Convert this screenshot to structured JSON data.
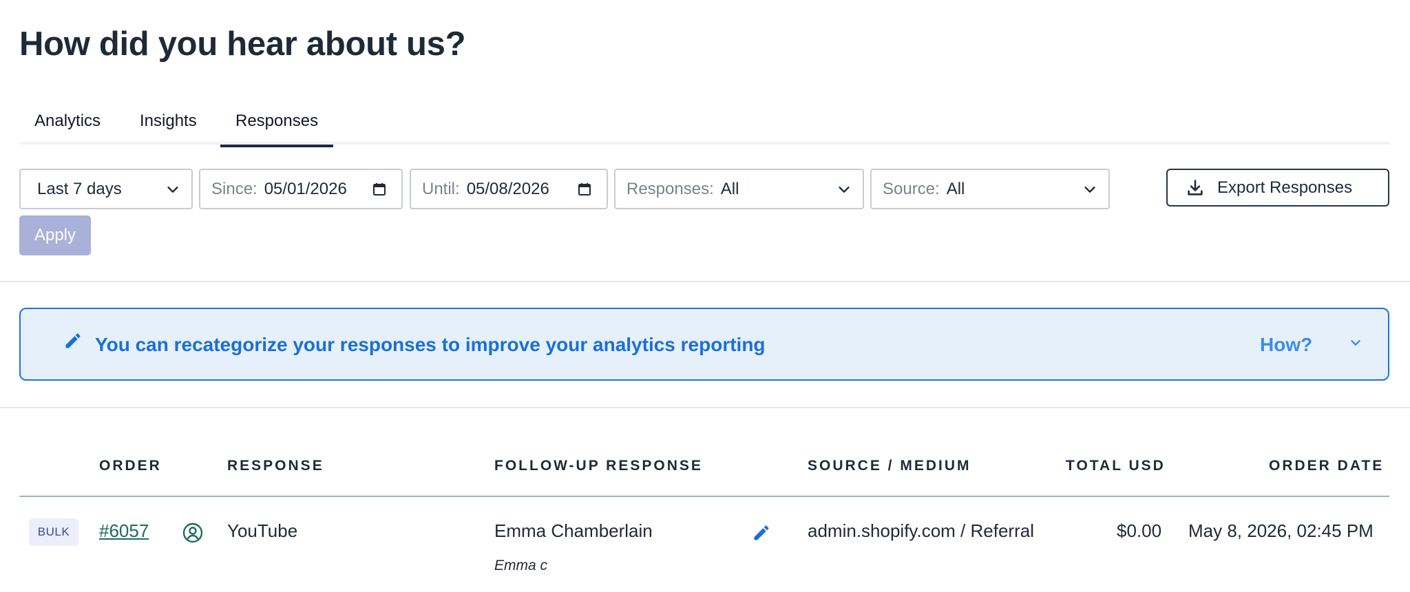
{
  "page": {
    "title": "How did you hear about us?"
  },
  "tabs": [
    {
      "label": "Analytics",
      "active": false
    },
    {
      "label": "Insights",
      "active": false
    },
    {
      "label": "Responses",
      "active": true
    }
  ],
  "filters": {
    "range": {
      "value": "Last 7 days",
      "icon": "chevron-down-icon"
    },
    "since": {
      "label": "Since:",
      "value": "05/01/2026",
      "icon": "calendar-icon"
    },
    "until": {
      "label": "Until:",
      "value": "05/08/2026",
      "icon": "calendar-icon"
    },
    "responses": {
      "label": "Responses:",
      "value": "All",
      "icon": "chevron-down-icon"
    },
    "source": {
      "label": "Source:",
      "value": "All",
      "icon": "chevron-down-icon"
    },
    "apply_label": "Apply"
  },
  "export": {
    "label": "Export Responses",
    "icon": "download-icon"
  },
  "banner": {
    "text": "You can recategorize your responses to improve your analytics reporting",
    "how_label": "How?",
    "icon": "pencil-icon"
  },
  "table": {
    "headers": [
      "ORDER",
      "RESPONSE",
      "FOLLOW-UP RESPONSE",
      "SOURCE / MEDIUM",
      "TOTAL USD",
      "ORDER DATE"
    ],
    "rows": [
      {
        "badge": "BULK",
        "order": "#6057",
        "response": "YouTube",
        "followup": "Emma Chamberlain",
        "followup_sub": "Emma c",
        "source_medium": "admin.shopify.com / Referral",
        "total": "$0.00",
        "date": "May 8, 2026, 02:45 PM"
      }
    ]
  },
  "colors": {
    "accent": "#1a73e8",
    "banner_bg": "#e6f0fb",
    "apply_disabled": "#a9b1d9",
    "link": "#1e6b5a"
  }
}
